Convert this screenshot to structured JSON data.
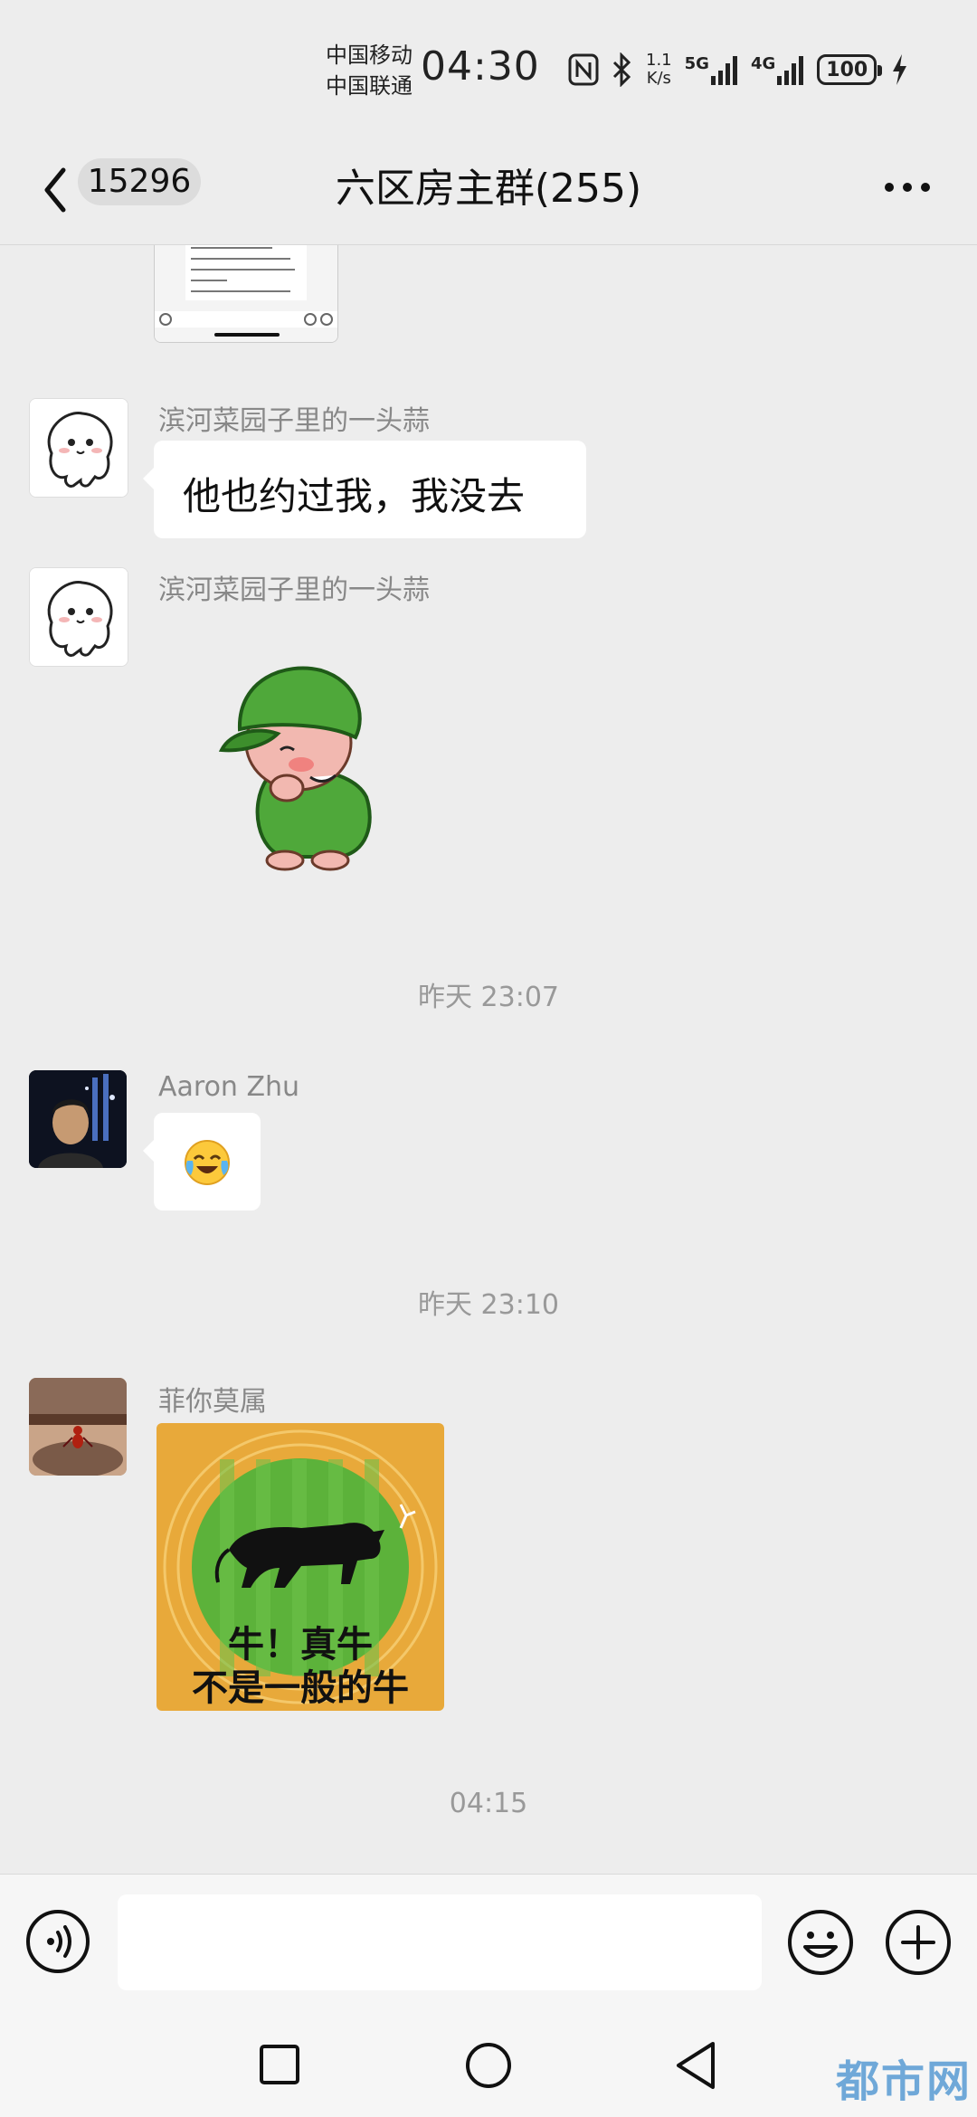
{
  "status_bar": {
    "carrier1": "中国移动",
    "carrier2": "中国联通",
    "time": "04:30",
    "speed_top": "1.1",
    "speed_unit": "K/s",
    "net1": "5G",
    "net2": "4G",
    "battery": "100"
  },
  "header": {
    "unread_count": "15296",
    "title": "六区房主群(255)"
  },
  "messages": [
    {
      "sender": "滨河菜园子里的一头蒜",
      "text": "他也约过我，我没去"
    },
    {
      "sender": "滨河菜园子里的一头蒜",
      "sticker": "soldier-sticker"
    },
    {
      "sender": "Aaron Zhu",
      "emoji": "😭"
    },
    {
      "sender": "菲你莫属",
      "sticker_line1": "牛！真牛",
      "sticker_line2": "不是一般的牛"
    }
  ],
  "timestamps": [
    "昨天 23:07",
    "昨天 23:10",
    "04:15"
  ],
  "input": {
    "value": "",
    "placeholder": ""
  },
  "watermark": "都市网",
  "colors": {
    "background": "#ededed",
    "bubble": "#ffffff",
    "sticker_bg": "#e8a93a",
    "sticker_green": "#5cb23a"
  }
}
